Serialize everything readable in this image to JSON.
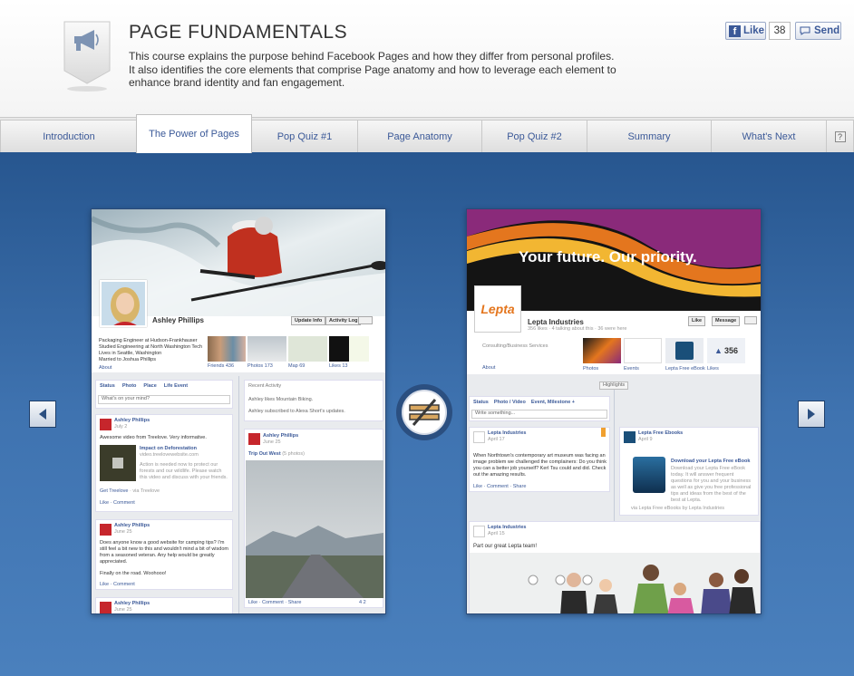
{
  "header": {
    "title": "PAGE FUNDAMENTALS",
    "description": "This course explains the purpose behind Facebook Pages and how they differ from personal profiles. It also identifies the core elements that comprise Page anatomy and how to leverage each element to enhance brand identity and fan engagement.",
    "badge_icon": "megaphone-icon"
  },
  "social": {
    "like_label": "Like",
    "like_count": "38",
    "send_label": "Send"
  },
  "tabs": [
    {
      "label": "Introduction"
    },
    {
      "label": "The Power of Pages"
    },
    {
      "label": "Pop Quiz #1"
    },
    {
      "label": "Page Anatomy"
    },
    {
      "label": "Pop Quiz #2"
    },
    {
      "label": "Summary"
    },
    {
      "label": "What's Next"
    }
  ],
  "help_label": "?",
  "profile": {
    "name": "Ashley Phillips",
    "update_info": "Update Info",
    "activity_log": "Activity Log",
    "info": [
      "Packaging Engineer at Hudson-Frankhauser",
      "Studied Engineering at North Washington Tech",
      "Lives in Seattle, Washington",
      "Married to Joshua Phillips"
    ],
    "about": "About",
    "apps": [
      "Friends 436",
      "Photos 173",
      "Map 69",
      "Likes 13"
    ],
    "composer": [
      "Status",
      "Photo",
      "Place",
      "Life Event"
    ],
    "composer_placeholder": "What's on your mind?",
    "recent_activity": "Recent Activity",
    "activity1": "Ashley likes Mountain Biking.",
    "activity2": "Ashley subscribed to Alexa Short's updates.",
    "post1_name": "Ashley Phillips",
    "post1_date": "July 2",
    "post1_text": "Awesome video from Treelove. Very informative.",
    "video_title": "Impact on Deforestation",
    "video_url": "video.treelovewebsite.com",
    "video_desc": "Action is needed now to protect our forests and our wildlife. Please watch this video and discuss with your friends.",
    "get_treelove": "Get Treelove",
    "via_treelove": "· via Treelove",
    "like_comment": "Like · Comment",
    "post2_name": "Ashley Phillips",
    "post2_date": "June 25",
    "post2_text": "Does anyone know a good website for camping tips? I'm still feel a bit new to this and wouldn't mind a bit of wisdom from a seasoned veteran. Any help would be greatly appreciated.",
    "post2_text2": "Finally on the road. Woohooo!",
    "post3_name": "Ashley Phillips",
    "post3_date": "June 25",
    "trip_title": "Trip Out West",
    "trip_count": "(5 photos)",
    "trip_actions": "Like · Comment · Share",
    "trip_counts": "4  2"
  },
  "page": {
    "cover_text": "Your future. Our priority.",
    "logo_text": "Lepta",
    "name": "Lepta Industries",
    "stats": "356 likes · 4 talking about this · 36 were here",
    "like_btn": "Like",
    "message_btn": "Message",
    "category": "Consulting/Business Services",
    "about": "About",
    "apps": [
      "Photos",
      "Events",
      "Lepta Free eBook",
      "Likes"
    ],
    "likes_count": "356",
    "highlights": "Highlights",
    "composer": [
      "Status",
      "Photo / Video",
      "Event, Milestone +"
    ],
    "composer_placeholder": "Write something...",
    "post1_name": "Lepta Industries",
    "post1_date": "April 17",
    "post1_text": "When Northtown's contemporary art museum was facing an image problem we challenged the complainers: Do you think you can a better job yourself? Kerl Tsu could and did. Check out the amazing results.",
    "post1_actions": "Like · Comment · Share",
    "ebook_name": "Lepta Free Ebooks",
    "ebook_date": "April 9",
    "ebook_title": "Download your Lepta Free eBook",
    "ebook_desc": "Download your Lepta Free eBook today. It will answer frequent questions for you and your business as well as give you free professional tips and ideas from the best of the best at Lepta.",
    "ebook_via": "via Lepta Free eBooks by Lepta Industries",
    "post2_name": "Lepta Industries",
    "post2_date": "April 15",
    "post2_text": "Part our great Lepta team!"
  },
  "colors": {
    "stage": "#3a6aa6",
    "fb_blue": "#3b5998",
    "header_bg": "#f4f4f4"
  }
}
